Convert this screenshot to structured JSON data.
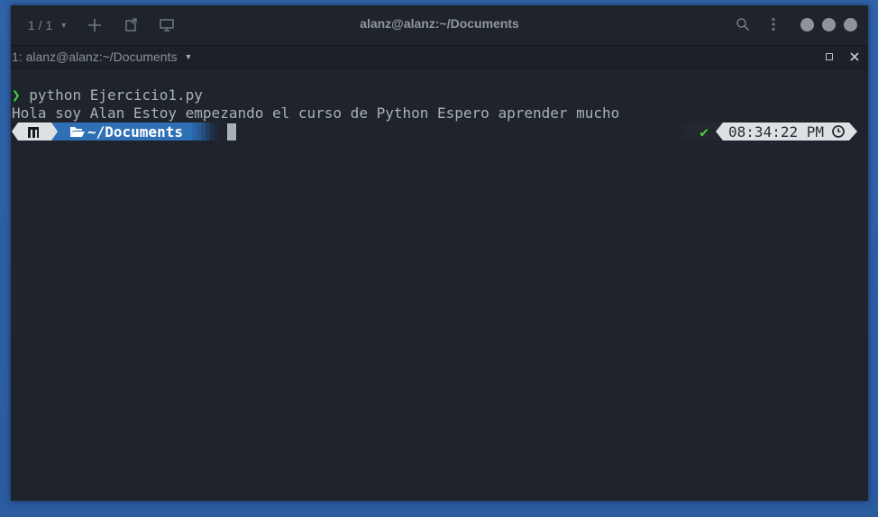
{
  "window": {
    "title": "alanz@alanz:~/Documents",
    "tab_count": "1 / 1"
  },
  "tabbar": {
    "tab_label": "1: alanz@alanz:~/Documents"
  },
  "terminal": {
    "prompt_symbol": "❯",
    "command": "python Ejercicio1.py",
    "output": "Hola soy Alan Estoy empezando el curso de Python Espero aprender mucho",
    "prompt_dir": "~/Documents",
    "status_symbol": "✔",
    "time": "08:34:22 PM"
  },
  "icons": {
    "add": "plus-icon",
    "detach": "detach-icon",
    "split": "split-icon",
    "search": "search-icon",
    "menu": "kebab-menu-icon",
    "folder": "folder-open-icon",
    "clock": "clock-icon",
    "os": "linux-logo-icon"
  },
  "colors": {
    "accent_blue": "#2f6fb6",
    "ok_green": "#47d13a",
    "terminal_bg": "#1f242c"
  }
}
